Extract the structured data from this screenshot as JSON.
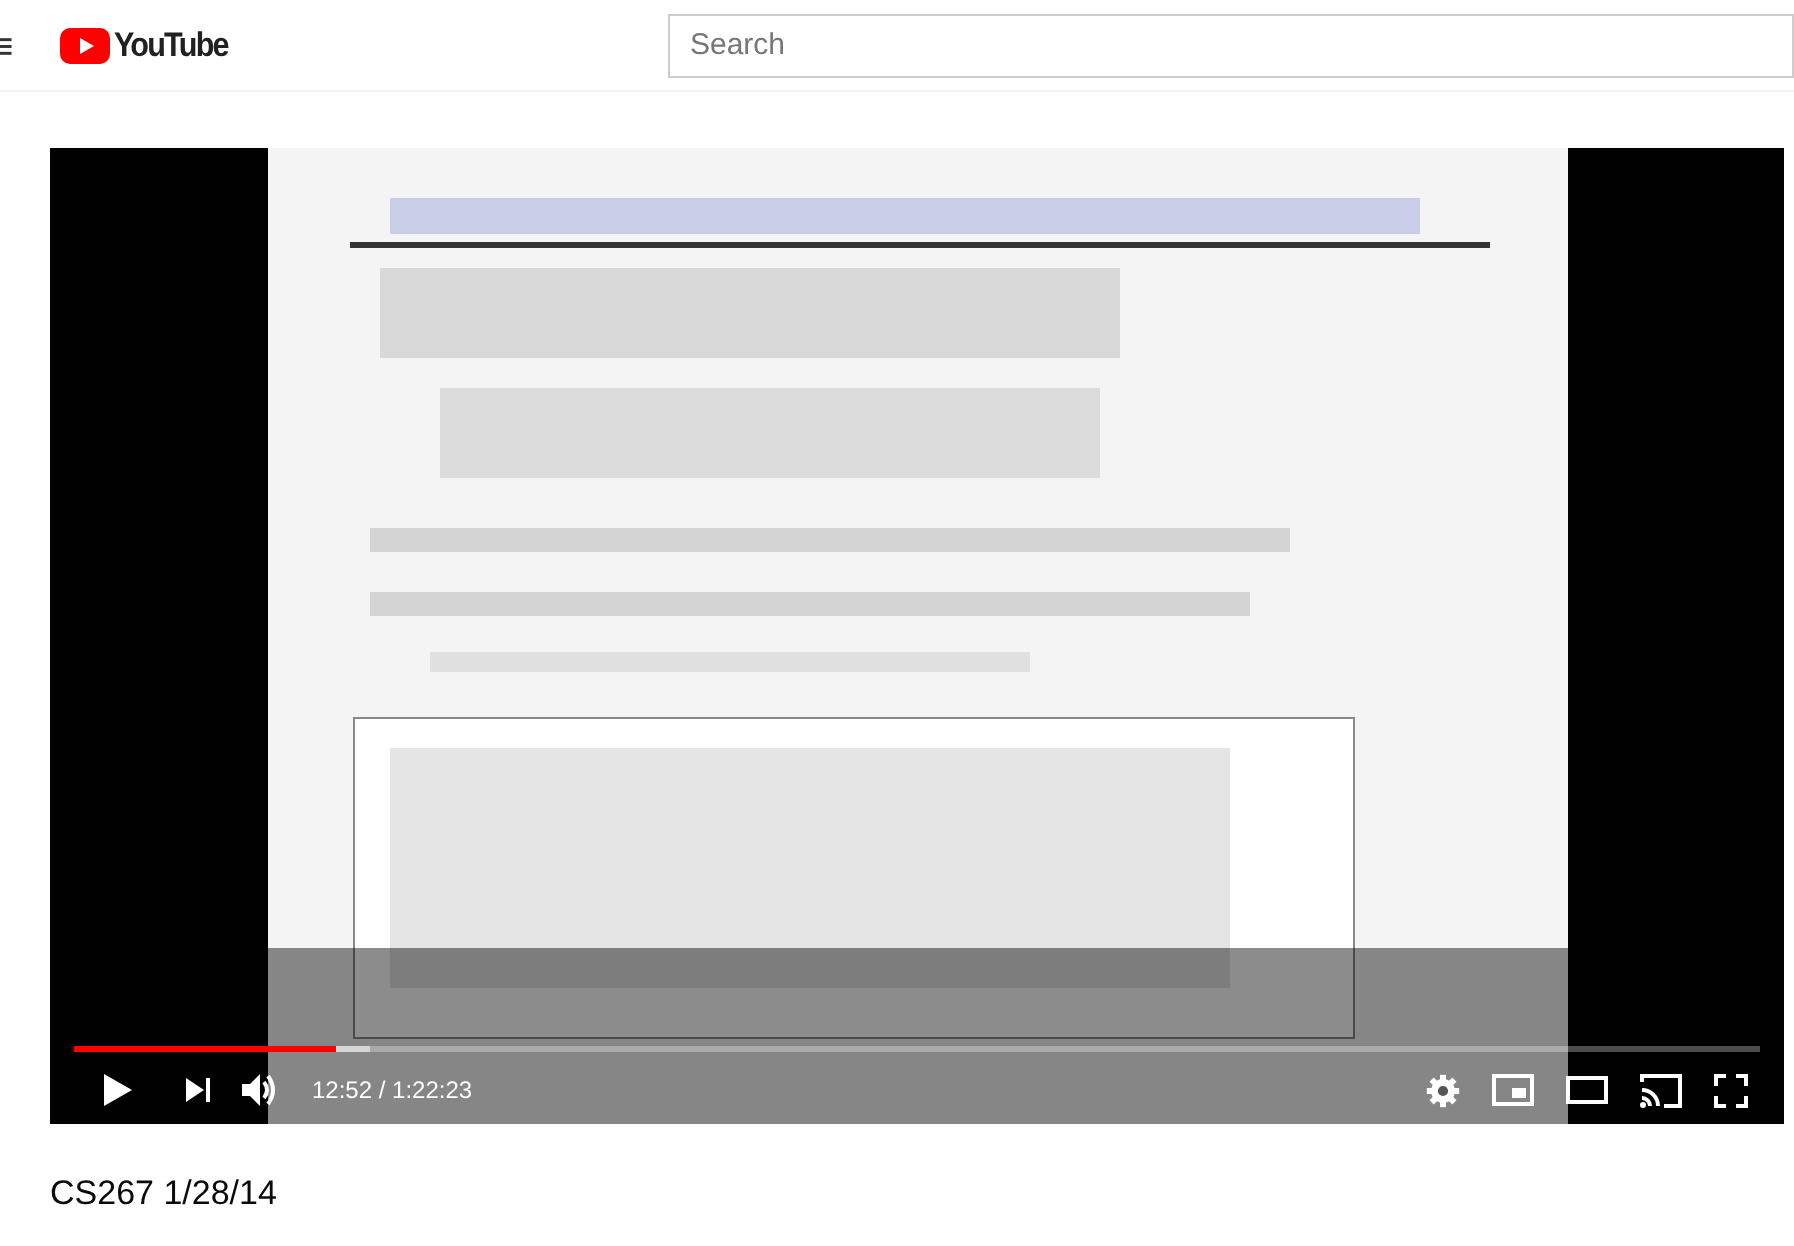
{
  "header": {
    "logo_text": "YouTube",
    "search": {
      "placeholder": "Search"
    }
  },
  "player": {
    "progress": {
      "level": 0.155
    },
    "time": "12:52 / 1:22:23"
  },
  "video_title": "CS267 1/28/14"
}
